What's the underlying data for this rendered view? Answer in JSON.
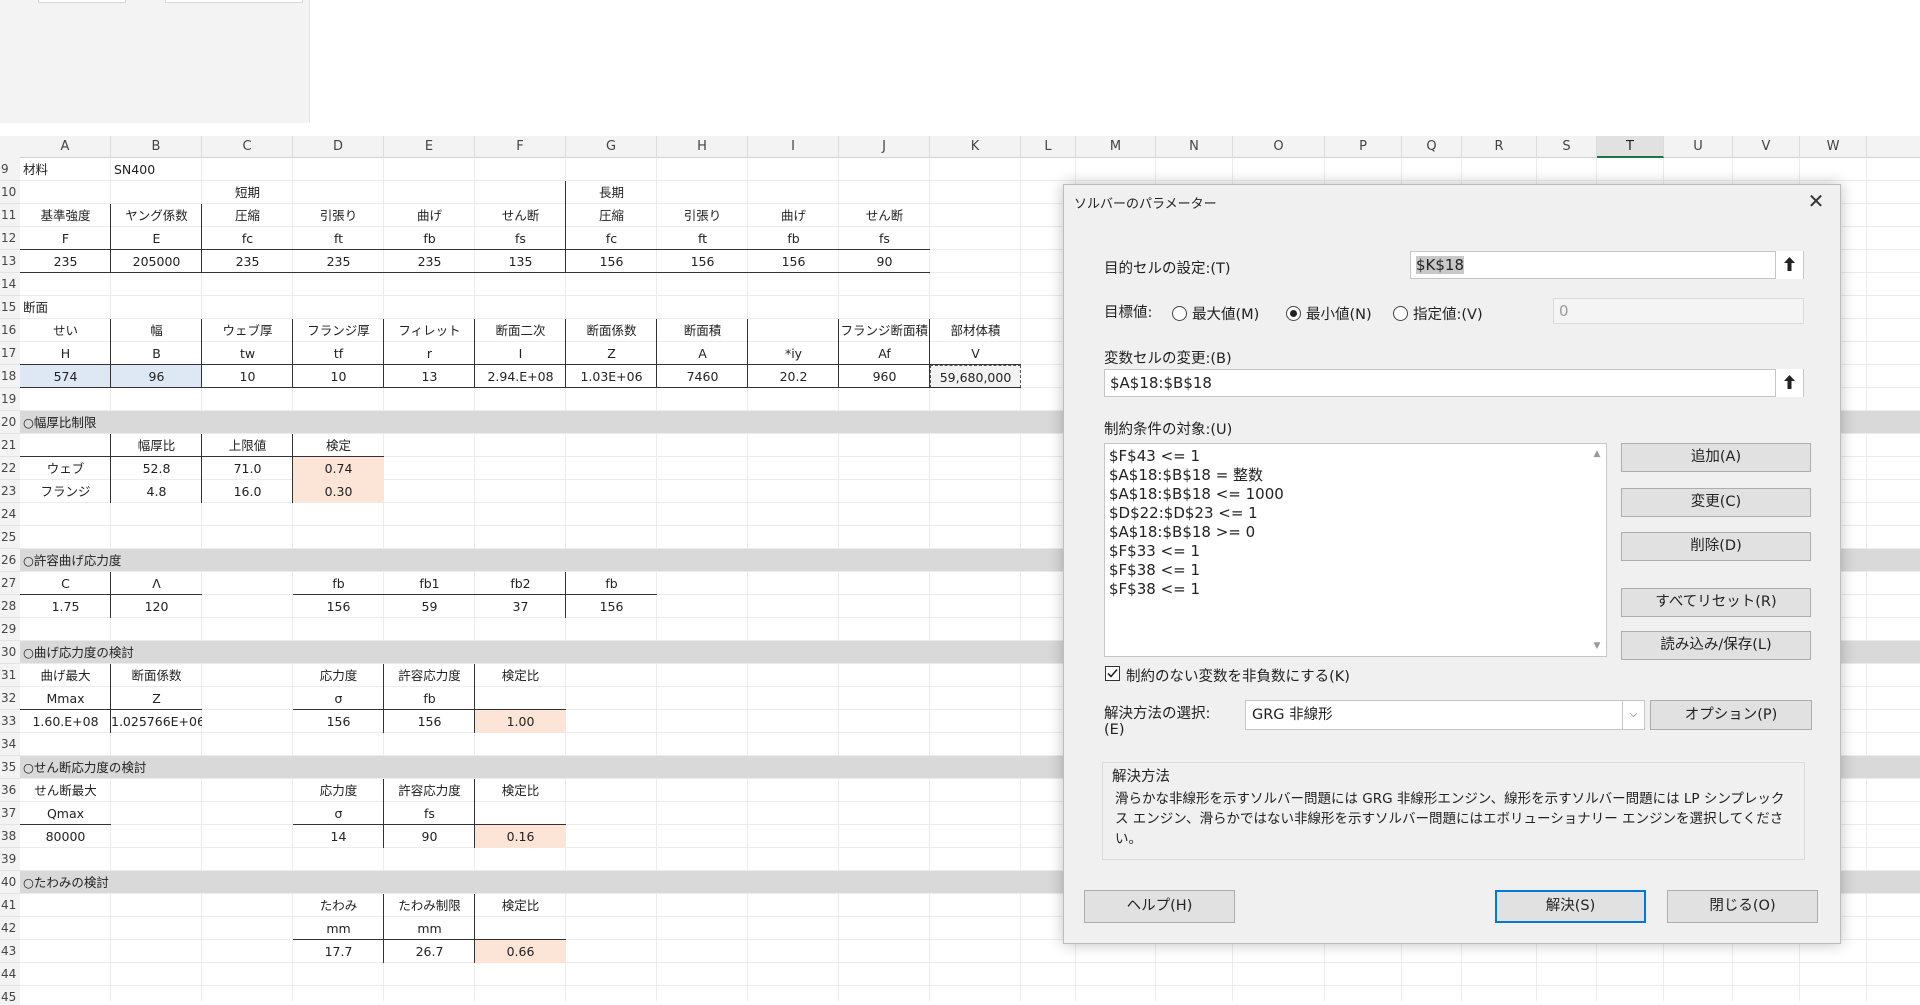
{
  "columns": [
    "A",
    "B",
    "C",
    "D",
    "E",
    "F",
    "G",
    "H",
    "I",
    "J",
    "K",
    "L",
    "M",
    "N",
    "O",
    "P",
    "Q",
    "R",
    "S",
    "T",
    "U",
    "V",
    "W"
  ],
  "selected_column": "T",
  "rows": [
    "9",
    "10",
    "11",
    "12",
    "13",
    "14",
    "15",
    "16",
    "17",
    "18",
    "19",
    "20",
    "21",
    "22",
    "23",
    "24",
    "25",
    "26",
    "27",
    "28",
    "29",
    "30",
    "31",
    "32",
    "33",
    "34",
    "35",
    "36",
    "37",
    "38",
    "39",
    "40",
    "41",
    "42",
    "43",
    "44",
    "45"
  ],
  "cells": {
    "a9": "材料",
    "b9": "SN400",
    "c10": "短期",
    "g10": "長期",
    "a11": "基準強度",
    "b11": "ヤング係数",
    "c11": "圧縮",
    "d11": "引張り",
    "e11": "曲げ",
    "f11": "せん断",
    "g11": "圧縮",
    "h11": "引張り",
    "i11": "曲げ",
    "j11": "せん断",
    "a12": "F",
    "b12": "E",
    "c12": "fc",
    "d12": "ft",
    "e12": "fb",
    "f12": "fs",
    "g12": "fc",
    "h12": "ft",
    "i12": "fb",
    "j12": "fs",
    "a13": "235",
    "b13": "205000",
    "c13": "235",
    "d13": "235",
    "e13": "235",
    "f13": "135",
    "g13": "156",
    "h13": "156",
    "i13": "156",
    "j13": "90",
    "a15": "断面",
    "a16": "せい",
    "b16": "幅",
    "c16": "ウェブ厚",
    "d16": "フランジ厚",
    "e16": "フィレット",
    "f16": "断面二次",
    "g16": "断面係数",
    "h16": "断面積",
    "j16": "フランジ断面積",
    "k16": "部材体積",
    "a17": "H",
    "b17": "B",
    "c17": "tw",
    "d17": "tf",
    "e17": "r",
    "f17": "I",
    "g17": "Z",
    "h17": "A",
    "i17": "*iy",
    "j17": "Af",
    "k17": "V",
    "a18": "574",
    "b18": "96",
    "c18": "10",
    "d18": "10",
    "e18": "13",
    "f18": "2.94.E+08",
    "g18": "1.03E+06",
    "h18": "7460",
    "i18": "20.2",
    "j18": "960",
    "k18": "59,680,000",
    "a20": "○幅厚比制限",
    "b21": "幅厚比",
    "c21": "上限値",
    "d21": "検定",
    "a22": "ウェブ",
    "b22": "52.8",
    "c22": "71.0",
    "d22": "0.74",
    "a23": "フランジ",
    "b23": "4.8",
    "c23": "16.0",
    "d23": "0.30",
    "a26": "○許容曲げ応力度",
    "a27": "C",
    "b27": "Λ",
    "d27": "fb",
    "e27": "fb1",
    "f27": "fb2",
    "g27": "fb",
    "a28": "1.75",
    "b28": "120",
    "d28": "156",
    "e28": "59",
    "f28": "37",
    "g28": "156",
    "a30": "○曲げ応力度の検討",
    "a31": "曲げ最大",
    "b31": "断面係数",
    "d31": "応力度",
    "e31": "許容応力度",
    "f31": "検定比",
    "a32": "Mmax",
    "b32": "Z",
    "d32": "σ",
    "e32": "fb",
    "a33": "1.60.E+08",
    "b33": "1.025766E+06",
    "d33": "156",
    "e33": "156",
    "f33": "1.00",
    "a35": "○せん断応力度の検討",
    "a36": "せん断最大",
    "d36": "応力度",
    "e36": "許容応力度",
    "f36": "検定比",
    "a37": "Qmax",
    "d37": "σ",
    "e37": "fs",
    "a38": "80000",
    "d38": "14",
    "e38": "90",
    "f38": "0.16",
    "a40": "○たわみの検討",
    "d41": "たわみ",
    "e41": "たわみ制限",
    "f41": "検定比",
    "d42": "mm",
    "e42": "mm",
    "d43": "17.7",
    "e43": "26.7",
    "f43": "0.66"
  },
  "dialog": {
    "title": "ソルバーのパラメーター",
    "close_glyph": "✕",
    "objective_label": "目的セルの設定:(T)",
    "objective_value": "$K$18",
    "target_label": "目標値:",
    "radio_max": "最大値(M)",
    "radio_min": "最小値(N)",
    "radio_value": "指定値:(V)",
    "selected_target": "min",
    "value_field": "0",
    "variable_label": "変数セルの変更:(B)",
    "variable_value": "$A$18:$B$18",
    "constraints_label": "制約条件の対象:(U)",
    "constraints": [
      "$F$43 <= 1",
      "$A$18:$B$18 = 整数",
      "$A$18:$B$18 <= 1000",
      "$D$22:$D$23 <= 1",
      "$A$18:$B$18 >= 0",
      "$F$33 <= 1",
      "$F$38 <= 1",
      "$F$38 <= 1"
    ],
    "btn_add": "追加(A)",
    "btn_change": "変更(C)",
    "btn_delete": "削除(D)",
    "btn_reset": "すべてリセット(R)",
    "btn_load_save": "読み込み/保存(L)",
    "nonneg_label": "制約のない変数を非負数にする(K)",
    "nonneg_checked": true,
    "method_label_1": "解決方法の選択:",
    "method_label_2": "(E)",
    "method_value": "GRG 非線形",
    "btn_options": "オプション(P)",
    "method_group_title": "解決方法",
    "method_desc": "滑らかな非線形を示すソルバー問題には GRG 非線形エンジン、線形を示すソルバー問題には LP シンプレックス エンジン、滑らかではない非線形を示すソルバー問題にはエボリューショナリー エンジンを選択してください。",
    "btn_help": "ヘルプ(H)",
    "btn_solve": "解決(S)",
    "btn_close": "閉じる(O)"
  }
}
